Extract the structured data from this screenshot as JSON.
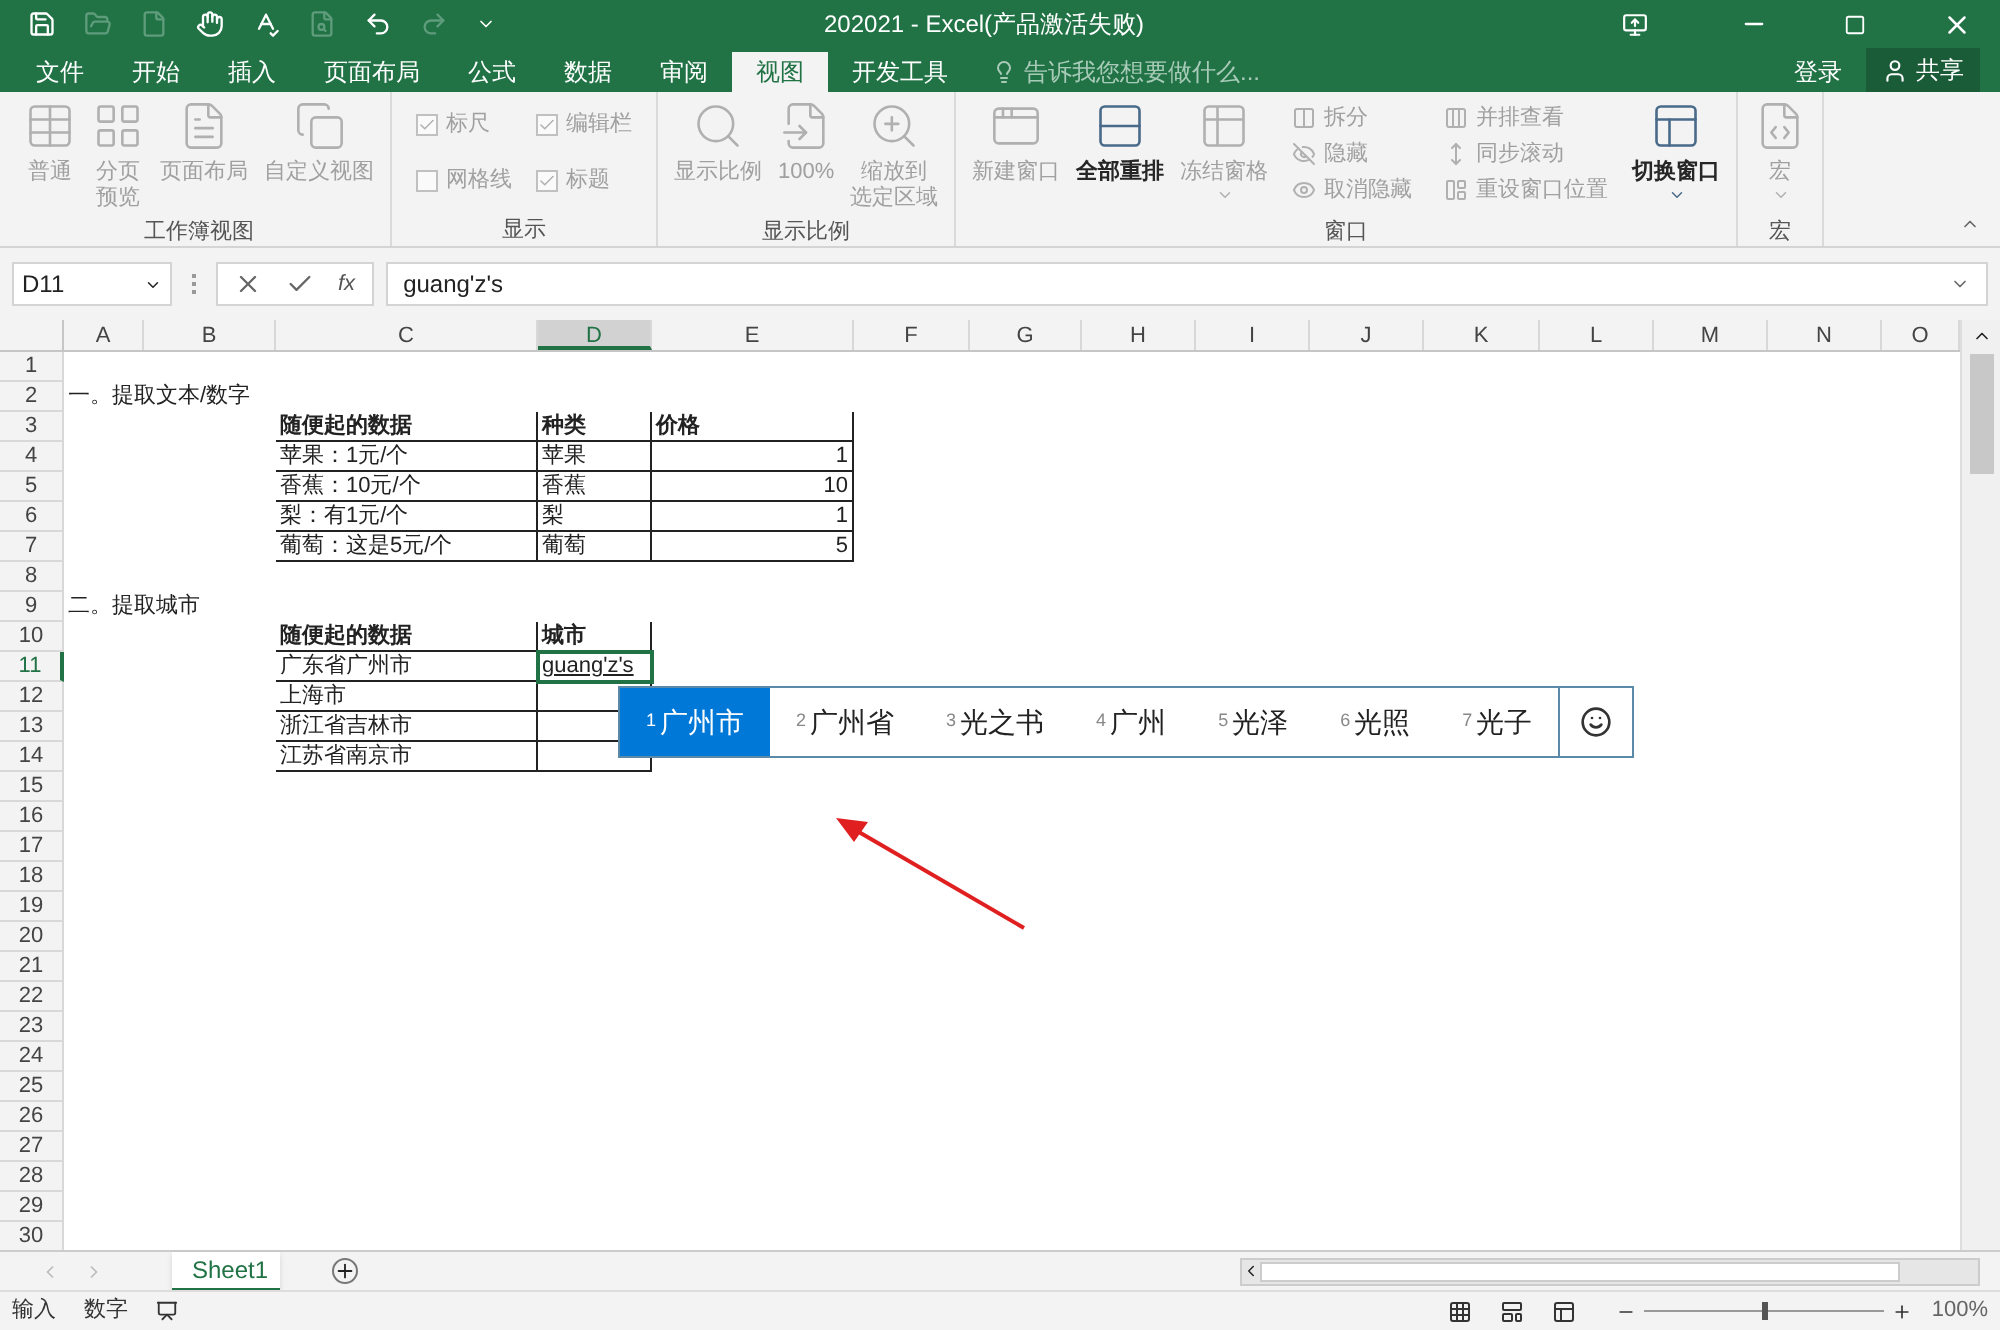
{
  "window": {
    "title": "202021 - Excel(产品激活失败)"
  },
  "quick_access": [
    {
      "disabled": false
    },
    {
      "disabled": true
    },
    {
      "disabled": true
    },
    {
      "disabled": false
    },
    {
      "disabled": false
    },
    {
      "disabled": true
    },
    {
      "disabled": false
    },
    {
      "disabled": true
    }
  ],
  "tabs": [
    {
      "label": "文件",
      "selected": false
    },
    {
      "label": "开始",
      "selected": false
    },
    {
      "label": "插入",
      "selected": false
    },
    {
      "label": "页面布局",
      "selected": false
    },
    {
      "label": "公式",
      "selected": false
    },
    {
      "label": "数据",
      "selected": false
    },
    {
      "label": "审阅",
      "selected": false
    },
    {
      "label": "视图",
      "selected": true
    },
    {
      "label": "开发工具",
      "selected": false
    }
  ],
  "tell_me": {
    "placeholder": "告诉我您想要做什么..."
  },
  "sign_in": "登录",
  "share": "共享",
  "ribbon": [
    {
      "label": "工作簿视图",
      "items": [
        {
          "kind": "large",
          "label": "普通",
          "disabled": true
        },
        {
          "kind": "large",
          "label_lines": [
            "分页",
            "预览"
          ],
          "disabled": true
        },
        {
          "kind": "large",
          "label": "页面布局",
          "disabled": true
        },
        {
          "kind": "large",
          "label": "自定义视图",
          "disabled": true
        }
      ]
    },
    {
      "label": "显示",
      "items": [
        {
          "kind": "checkbox",
          "label": "标尺",
          "checked": true,
          "disabled": true
        },
        {
          "kind": "checkbox",
          "label": "编辑栏",
          "checked": true,
          "disabled": true
        },
        {
          "kind": "checkbox",
          "label": "网格线",
          "checked": false,
          "disabled": true
        },
        {
          "kind": "checkbox",
          "label": "标题",
          "checked": true,
          "disabled": true
        }
      ]
    },
    {
      "label": "显示比例",
      "items": [
        {
          "kind": "large",
          "label": "显示比例",
          "disabled": true
        },
        {
          "kind": "large",
          "label": "100%",
          "disabled": true
        },
        {
          "kind": "large",
          "label_lines": [
            "缩放到",
            "选定区域"
          ],
          "disabled": true
        }
      ]
    },
    {
      "label": "窗口",
      "items": [
        {
          "kind": "large",
          "label": "新建窗口",
          "disabled": true
        },
        {
          "kind": "large",
          "label": "全部重排",
          "disabled": false
        },
        {
          "kind": "large",
          "label": "冻结窗格",
          "disabled": true,
          "dropdown": true
        },
        {
          "kind": "small",
          "label": "拆分",
          "disabled": true
        },
        {
          "kind": "small",
          "label": "隐藏",
          "disabled": true
        },
        {
          "kind": "small",
          "label": "取消隐藏",
          "disabled": true
        },
        {
          "kind": "small",
          "label": "并排查看",
          "disabled": true
        },
        {
          "kind": "small",
          "label": "同步滚动",
          "disabled": true
        },
        {
          "kind": "small",
          "label": "重设窗口位置",
          "disabled": true
        },
        {
          "kind": "large",
          "label": "切换窗口",
          "disabled": false,
          "dropdown": true
        }
      ]
    },
    {
      "label": "宏",
      "items": [
        {
          "kind": "large",
          "label": "宏",
          "disabled": true,
          "dropdown": true
        }
      ]
    }
  ],
  "formula_bar": {
    "name_box": "D11",
    "function_symbol": "fx",
    "value": "guang'z's"
  },
  "columns": [
    {
      "label": "A",
      "selected": false
    },
    {
      "label": "B",
      "selected": false
    },
    {
      "label": "C",
      "selected": false
    },
    {
      "label": "D",
      "selected": true
    },
    {
      "label": "E",
      "selected": false
    },
    {
      "label": "F",
      "selected": false
    },
    {
      "label": "G",
      "selected": false
    },
    {
      "label": "H",
      "selected": false
    },
    {
      "label": "I",
      "selected": false
    },
    {
      "label": "J",
      "selected": false
    },
    {
      "label": "K",
      "selected": false
    },
    {
      "label": "L",
      "selected": false
    },
    {
      "label": "M",
      "selected": false
    },
    {
      "label": "N",
      "selected": false
    },
    {
      "label": "O",
      "selected": false
    }
  ],
  "rows": [
    {
      "number": "1",
      "selected": false
    },
    {
      "number": "2",
      "selected": false,
      "cells": [
        {
          "text": "一。提取文本/数字"
        }
      ]
    },
    {
      "number": "3",
      "selected": false,
      "cells": [
        {},
        {},
        {
          "text": "随便起的数据",
          "bold": true,
          "bordered": true
        },
        {
          "text": "种类",
          "bold": true,
          "bordered": true
        },
        {
          "text": "价格",
          "bold": true,
          "bordered": true
        }
      ]
    },
    {
      "number": "4",
      "selected": false,
      "cells": [
        {},
        {},
        {
          "text": "苹果：1元/个",
          "bordered": true
        },
        {
          "text": "苹果",
          "bordered": true
        },
        {
          "text": "1",
          "align_right": true,
          "bordered": true
        }
      ]
    },
    {
      "number": "5",
      "selected": false,
      "cells": [
        {},
        {},
        {
          "text": "香蕉：10元/个",
          "bordered": true
        },
        {
          "text": "香蕉",
          "bordered": true
        },
        {
          "text": "10",
          "align_right": true,
          "bordered": true
        }
      ]
    },
    {
      "number": "6",
      "selected": false,
      "cells": [
        {},
        {},
        {
          "text": "梨：有1元/个",
          "bordered": true
        },
        {
          "text": "梨",
          "bordered": true
        },
        {
          "text": "1",
          "align_right": true,
          "bordered": true
        }
      ]
    },
    {
      "number": "7",
      "selected": false,
      "cells": [
        {},
        {},
        {
          "text": "葡萄：这是5元/个",
          "bordered": true
        },
        {
          "text": "葡萄",
          "bordered": true
        },
        {
          "text": "5",
          "align_right": true,
          "bordered": true
        }
      ]
    },
    {
      "number": "8",
      "selected": false
    },
    {
      "number": "9",
      "selected": false,
      "cells": [
        {
          "text": "二。提取城市"
        }
      ]
    },
    {
      "number": "10",
      "selected": false,
      "cells": [
        {},
        {},
        {
          "text": "随便起的数据",
          "bold": true,
          "bordered": true
        },
        {
          "text": "城市",
          "bold": true,
          "bordered": true
        }
      ]
    },
    {
      "number": "11",
      "selected": true,
      "cells": [
        {},
        {},
        {
          "text": "广东省广州市",
          "bordered": true
        },
        {
          "text": "guang'z's",
          "bordered": true,
          "active": true,
          "underline": true
        }
      ]
    },
    {
      "number": "12",
      "selected": false,
      "cells": [
        {},
        {},
        {
          "text": "上海市",
          "bordered": true
        },
        {
          "bordered": true
        }
      ]
    },
    {
      "number": "13",
      "selected": false,
      "cells": [
        {},
        {},
        {
          "text": "浙江省吉林市",
          "bordered": true
        },
        {
          "bordered": true
        }
      ]
    },
    {
      "number": "14",
      "selected": false,
      "cells": [
        {},
        {},
        {
          "text": "江苏省南京市",
          "bordered": true
        },
        {
          "bordered": true
        }
      ]
    },
    {
      "number": "15",
      "selected": false
    },
    {
      "number": "16",
      "selected": false
    },
    {
      "number": "17",
      "selected": false
    },
    {
      "number": "18",
      "selected": false
    },
    {
      "number": "19",
      "selected": false
    },
    {
      "number": "20",
      "selected": false
    },
    {
      "number": "21",
      "selected": false
    },
    {
      "number": "22",
      "selected": false
    },
    {
      "number": "23",
      "selected": false
    },
    {
      "number": "24",
      "selected": false
    },
    {
      "number": "25",
      "selected": false
    },
    {
      "number": "26",
      "selected": false
    },
    {
      "number": "27",
      "selected": false
    },
    {
      "number": "28",
      "selected": false
    },
    {
      "number": "29",
      "selected": false
    },
    {
      "number": "30",
      "selected": false
    }
  ],
  "ime_candidates": [
    {
      "index": "1",
      "text": "广州市",
      "selected": true
    },
    {
      "index": "2",
      "text": "广州省",
      "selected": false
    },
    {
      "index": "3",
      "text": "光之书",
      "selected": false
    },
    {
      "index": "4",
      "text": "广州",
      "selected": false
    },
    {
      "index": "5",
      "text": "光泽",
      "selected": false
    },
    {
      "index": "6",
      "text": "光照",
      "selected": false
    },
    {
      "index": "7",
      "text": "光子",
      "selected": false
    }
  ],
  "sheet_tabs": [
    {
      "label": "Sheet1",
      "selected": true
    }
  ],
  "status_bar": {
    "items": [
      "输入",
      "数字"
    ],
    "zoom": {
      "level": 0.5,
      "reading": "100%"
    }
  }
}
